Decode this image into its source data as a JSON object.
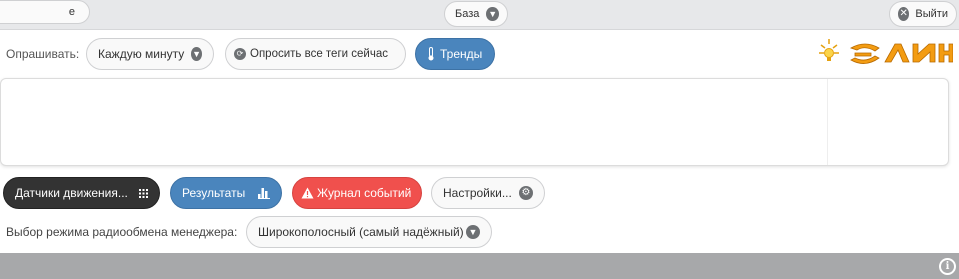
{
  "topbar": {
    "left_fragment": "e",
    "db_label": "База",
    "db_icon": "chevron-down-icon",
    "exit_label": "Выйти",
    "exit_icon": "close-circle-icon"
  },
  "controls": {
    "poll_label": "Опрашивать:",
    "poll_value": "Каждую минуту",
    "poll_all_label": "Опросить все теги сейчас",
    "poll_all_icon": "refresh-icon",
    "trends_label": "Тренды",
    "trends_icon": "thermometer-icon"
  },
  "logo": {
    "text": "ЭЛИН",
    "color": "#f39c12"
  },
  "actions": {
    "sensors_label": "Датчики движения...",
    "sensors_icon": "grid-icon",
    "results_label": "Результаты",
    "results_icon": "bar-chart-icon",
    "log_label": "Журнал событий",
    "log_icon": "warning-icon",
    "settings_label": "Настройки...",
    "settings_icon": "gear-icon"
  },
  "radio": {
    "label": "Выбор режима радиообмена менеджера:",
    "value": "Широкополосный (самый надёжный)"
  },
  "footer": {
    "info_icon": "info-icon"
  },
  "colors": {
    "blue": "#4a85bd",
    "dark": "#333333",
    "red": "#f0504d",
    "topbar": "#e7e8ea",
    "footer": "#a7a8aa"
  }
}
